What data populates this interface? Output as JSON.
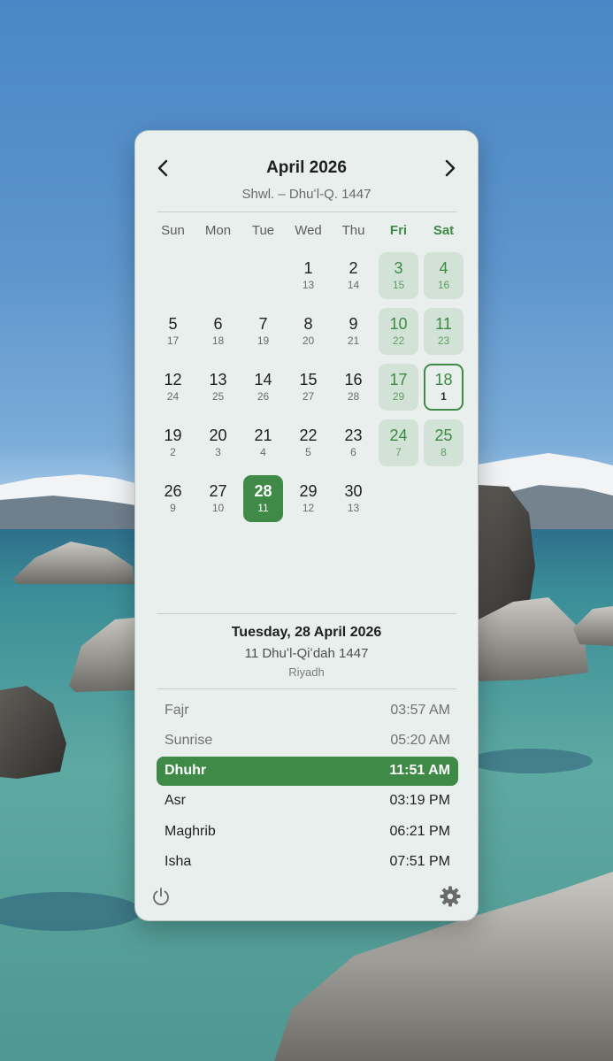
{
  "header": {
    "month_title": "April 2026",
    "hijri_range": "Shwl. – Dhuʻl-Q. 1447",
    "prev_icon": "chevron-left-icon",
    "next_icon": "chevron-right-icon"
  },
  "weekdays": [
    "Sun",
    "Mon",
    "Tue",
    "Wed",
    "Thu",
    "Fri",
    "Sat"
  ],
  "weekend_days": [
    "Fri",
    "Sat"
  ],
  "calendar": {
    "leading_blanks": 3,
    "days": [
      {
        "g": "1",
        "h": "13"
      },
      {
        "g": "2",
        "h": "14"
      },
      {
        "g": "3",
        "h": "15"
      },
      {
        "g": "4",
        "h": "16"
      },
      {
        "g": "5",
        "h": "17"
      },
      {
        "g": "6",
        "h": "18"
      },
      {
        "g": "7",
        "h": "19"
      },
      {
        "g": "8",
        "h": "20"
      },
      {
        "g": "9",
        "h": "21"
      },
      {
        "g": "10",
        "h": "22"
      },
      {
        "g": "11",
        "h": "23"
      },
      {
        "g": "12",
        "h": "24"
      },
      {
        "g": "13",
        "h": "25"
      },
      {
        "g": "14",
        "h": "26"
      },
      {
        "g": "15",
        "h": "27"
      },
      {
        "g": "16",
        "h": "28"
      },
      {
        "g": "17",
        "h": "29"
      },
      {
        "g": "18",
        "h": "1"
      },
      {
        "g": "19",
        "h": "2"
      },
      {
        "g": "20",
        "h": "3"
      },
      {
        "g": "21",
        "h": "4"
      },
      {
        "g": "22",
        "h": "5"
      },
      {
        "g": "23",
        "h": "6"
      },
      {
        "g": "24",
        "h": "7"
      },
      {
        "g": "25",
        "h": "8"
      },
      {
        "g": "26",
        "h": "9"
      },
      {
        "g": "27",
        "h": "10"
      },
      {
        "g": "28",
        "h": "11"
      },
      {
        "g": "29",
        "h": "12"
      },
      {
        "g": "30",
        "h": "13"
      }
    ],
    "today": "28",
    "outlined": "18"
  },
  "selected_day": {
    "date": "Tuesday, 28 April 2026",
    "hijri": "11 Dhuʻl-Qiʻdah 1447",
    "city": "Riyadh"
  },
  "prayers": [
    {
      "name": "Fajr",
      "time": "03:57 AM",
      "state": "past"
    },
    {
      "name": "Sunrise",
      "time": "05:20 AM",
      "state": "past"
    },
    {
      "name": "Dhuhr",
      "time": "11:51 AM",
      "state": "current"
    },
    {
      "name": "Asr",
      "time": "03:19 PM",
      "state": "upcoming"
    },
    {
      "name": "Maghrib",
      "time": "06:21 PM",
      "state": "upcoming"
    },
    {
      "name": "Isha",
      "time": "07:51 PM",
      "state": "upcoming"
    }
  ],
  "footer": {
    "power_icon": "power-icon",
    "settings_icon": "gear-icon"
  },
  "colors": {
    "accent": "#3f8a46",
    "weekend_fill": "#d3e2d6",
    "panel_bg": "#e8efed"
  }
}
